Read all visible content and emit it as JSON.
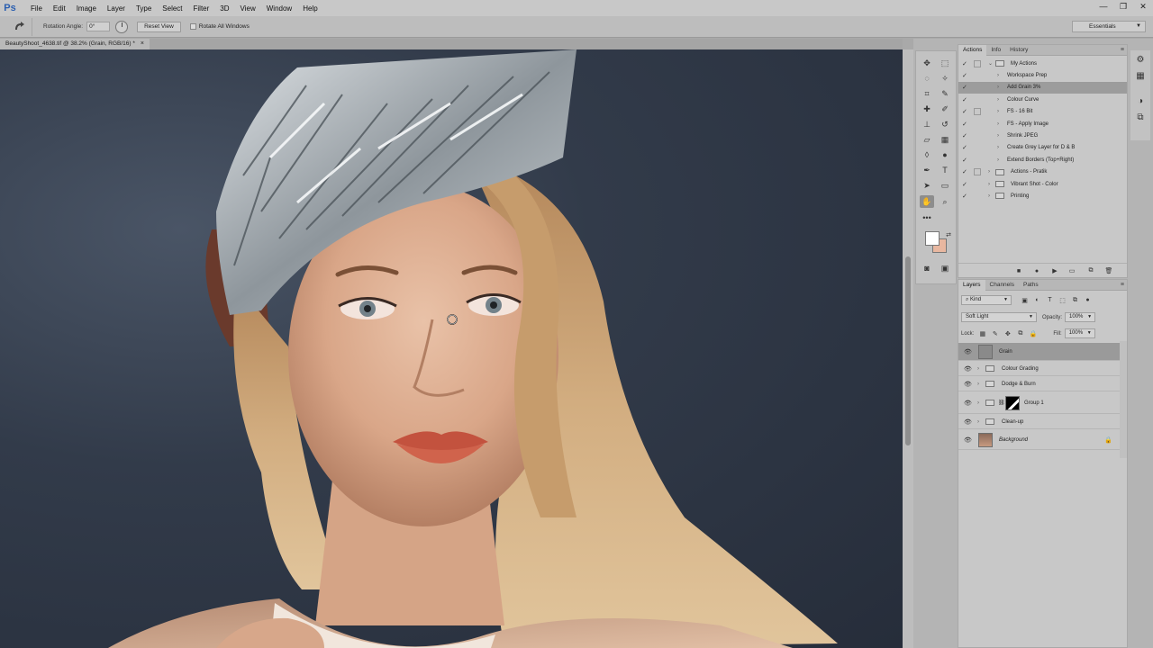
{
  "app": {
    "logo": "Ps"
  },
  "menu": [
    "File",
    "Edit",
    "Image",
    "Layer",
    "Type",
    "Select",
    "Filter",
    "3D",
    "View",
    "Window",
    "Help"
  ],
  "window_controls": {
    "minimize": "—",
    "restore": "❐",
    "close": "✕"
  },
  "options_bar": {
    "rotation_label": "Rotation Angle:",
    "rotation_value": "0°",
    "reset_view": "Reset View",
    "rotate_all": "Rotate All Windows",
    "workspace": "Essentials"
  },
  "document": {
    "tab_title": "BeautyShoot_4638.tif @ 38.2% (Grain, RGB/16) *",
    "close": "×"
  },
  "colors": {
    "foreground": "#ffffff",
    "background": "#e8b7a0",
    "selection": "#9c9c9c"
  },
  "actions_panel": {
    "tabs": [
      "Actions",
      "Info",
      "History"
    ],
    "items": [
      {
        "label": "My Actions",
        "indent": 0,
        "folder": true,
        "expanded": true,
        "dialog": true,
        "selected": false
      },
      {
        "label": "Workspace Prep",
        "indent": 1,
        "folder": false,
        "expanded": false,
        "dialog": false,
        "selected": false
      },
      {
        "label": "Add Grain 3%",
        "indent": 1,
        "folder": false,
        "expanded": false,
        "dialog": false,
        "selected": true
      },
      {
        "label": "Colour Curve",
        "indent": 1,
        "folder": false,
        "expanded": false,
        "dialog": false,
        "selected": false
      },
      {
        "label": "FS - 16 Bit",
        "indent": 1,
        "folder": false,
        "expanded": false,
        "dialog": true,
        "selected": false
      },
      {
        "label": "FS - Apply Image",
        "indent": 1,
        "folder": false,
        "expanded": false,
        "dialog": false,
        "selected": false
      },
      {
        "label": "Shrink JPEG",
        "indent": 1,
        "folder": false,
        "expanded": false,
        "dialog": false,
        "selected": false
      },
      {
        "label": "Create Grey Layer for D & B",
        "indent": 1,
        "folder": false,
        "expanded": false,
        "dialog": false,
        "selected": false
      },
      {
        "label": "Extend Borders (Top+Right)",
        "indent": 1,
        "folder": false,
        "expanded": false,
        "dialog": false,
        "selected": false
      },
      {
        "label": "Actions - Pratik",
        "indent": 0,
        "folder": true,
        "expanded": false,
        "dialog": true,
        "selected": false
      },
      {
        "label": "Vibrant Shot - Color",
        "indent": 0,
        "folder": true,
        "expanded": false,
        "dialog": false,
        "selected": false
      },
      {
        "label": "Printing",
        "indent": 0,
        "folder": true,
        "expanded": false,
        "dialog": false,
        "selected": false
      }
    ],
    "footer_icons": [
      "stop-icon",
      "record-icon",
      "play-icon",
      "new-set-icon",
      "new-action-icon",
      "delete-icon"
    ]
  },
  "layers_panel": {
    "tabs": [
      "Layers",
      "Channels",
      "Paths"
    ],
    "filter_kind": "Kind",
    "blend_mode": "Soft Light",
    "opacity_label": "Opacity:",
    "opacity_value": "100%",
    "fill_label": "Fill:",
    "fill_value": "100%",
    "lock_label": "Lock:",
    "layers": [
      {
        "name": "Grain",
        "type": "layer",
        "selected": true,
        "visible": true
      },
      {
        "name": "Colour Grading",
        "type": "group",
        "selected": false,
        "visible": true
      },
      {
        "name": "Dodge & Burn",
        "type": "group",
        "selected": false,
        "visible": true
      },
      {
        "name": "Group 1",
        "type": "group-mask",
        "selected": false,
        "visible": true
      },
      {
        "name": "Clean-up",
        "type": "group",
        "selected": false,
        "visible": true
      },
      {
        "name": "Background",
        "type": "background",
        "selected": false,
        "visible": true,
        "locked": true
      }
    ]
  }
}
